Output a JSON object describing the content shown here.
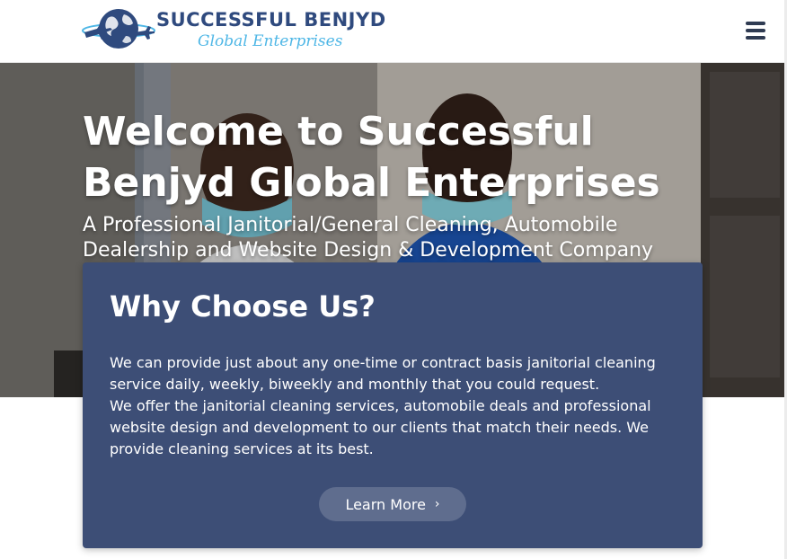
{
  "header": {
    "logo_name": "SUCCESSFUL BENJYD",
    "logo_tagline": "Global Enterprises",
    "menu_icon": "hamburger-menu-icon",
    "logo_icon": "globe-airplane-icon"
  },
  "hero": {
    "title_line1": "Welcome to Successful",
    "title_line2": "Benjyd Global Enterprises",
    "subtitle_line1": "A Professional Janitorial/General Cleaning, Automobile",
    "subtitle_line2": "Dealership and Website Design & Development Company"
  },
  "card": {
    "title": "Why Choose Us?",
    "paragraph1": "We can provide just about any one-time or contract basis janitorial cleaning service daily, weekly, biweekly and monthly that you could request.",
    "paragraph2": "We offer the janitorial cleaning services, automobile deals and professional website design and development to our clients that match their needs. We provide cleaning services at its best.",
    "button_label": "Learn More",
    "button_icon": "chevron-right-icon"
  },
  "colors": {
    "brand_navy": "#2f4a7e",
    "brand_light_blue": "#4fb7e6",
    "card_background": "#3d4e76",
    "button_background": "#5f6d8e"
  }
}
